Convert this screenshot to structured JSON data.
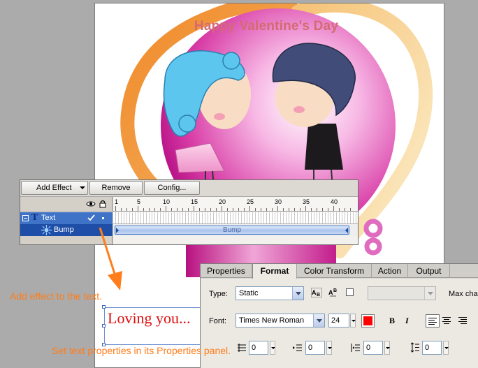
{
  "stage": {
    "title": "Happy Valentine's Day",
    "text_content": "Loving you..."
  },
  "timeline": {
    "toolbar": {
      "add_effect_label": "Add Effect",
      "remove_label": "Remove",
      "config_label": "Config..."
    },
    "tree": {
      "text_label": "Text",
      "bump_label": "Bump"
    },
    "ruler_ticks": [
      "1",
      "5",
      "10",
      "15",
      "20",
      "25",
      "30",
      "35",
      "40"
    ],
    "effect_bar_label": "Bump"
  },
  "properties": {
    "tabs": [
      "Properties",
      "Format",
      "Color Transform",
      "Action",
      "Output"
    ],
    "active_tab": "Format",
    "type_label": "Type:",
    "type_value": "Static",
    "max_chars_label": "Max chars",
    "font_label": "Font:",
    "font_value": "Times New Roman",
    "size_value": "24",
    "text_color": "#ff0000",
    "bold_label": "B",
    "italic_label": "I",
    "spacing": [
      "0",
      "0",
      "0",
      "0"
    ]
  },
  "annotations": {
    "effect_hint": "Add effect to the text.",
    "properties_hint": "Set text properties in its Properties panel."
  },
  "colors": {
    "title": "#d46a73",
    "annotation": "#ff7d1a",
    "selection": "#3f73c8"
  },
  "icons": [
    "eye-icon",
    "lock-icon",
    "text-t-icon",
    "check-icon",
    "bump-effect-icon",
    "vertical-text-icon",
    "superscript-icon",
    "letter-spacing-icon",
    "indent-icon",
    "left-margin-icon",
    "line-spacing-icon"
  ]
}
